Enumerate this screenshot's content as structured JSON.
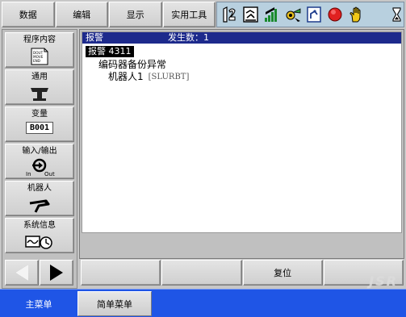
{
  "top_menu": {
    "items": [
      "数据",
      "编辑",
      "显示",
      "实用工具"
    ]
  },
  "status_icons": [
    "coordinate-icon",
    "teach-mode-icon",
    "speed-bars-icon",
    "servo-icon",
    "robot-monitor-icon",
    "alarm-stop-icon",
    "hand-icon",
    "hourglass-icon"
  ],
  "side_menu": {
    "items": [
      {
        "label": "程序内容",
        "icon": "job-content-icon",
        "icon_text": [
          "DOUT",
          "MOVE",
          "END"
        ]
      },
      {
        "label": "通用",
        "icon": "general-stand-icon"
      },
      {
        "label": "变量",
        "icon": "variable-icon",
        "value": "B001"
      },
      {
        "label": "输入/输出",
        "icon": "io-icon",
        "in": "In",
        "out": "Out"
      },
      {
        "label": "机器人",
        "icon": "robot-arm-icon"
      },
      {
        "label": "系统信息",
        "icon": "system-info-icon"
      }
    ]
  },
  "alarm": {
    "header_title": "报警",
    "count_label": "发生数：1",
    "code": "报警 4311",
    "name": "编码器备份异常",
    "detail": "机器人1",
    "tag": "[SLURBT]"
  },
  "function_bar": {
    "buttons": [
      "",
      "",
      "复位",
      ""
    ]
  },
  "bottom_tabs": {
    "main": "主菜单",
    "simple": "简单菜单"
  },
  "watermark": "JSR",
  "colors": {
    "header_bg": "#1d2a8c",
    "bottom_bar": "#1f55e6",
    "status_bar": "#b8d0df",
    "alarm_red": "#e02020"
  }
}
